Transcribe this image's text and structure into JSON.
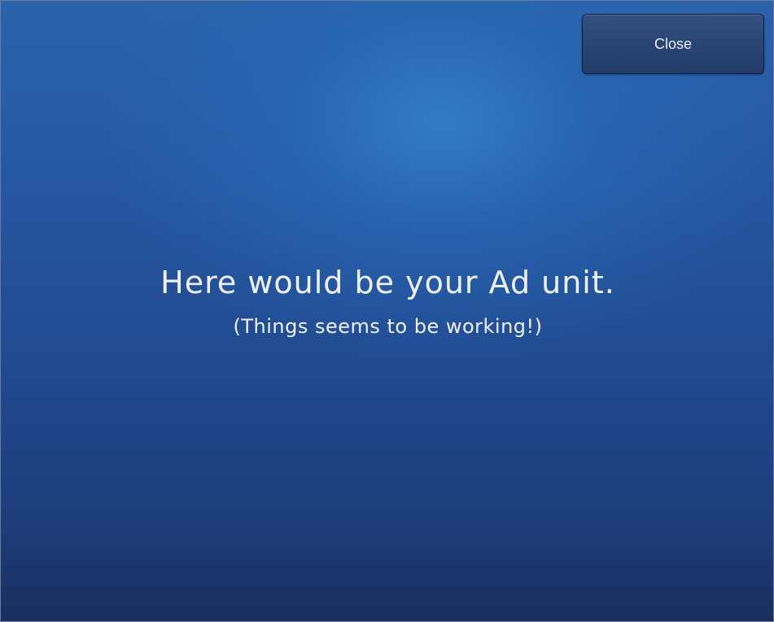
{
  "ad": {
    "close_label": "Close",
    "headline": "Here would be your Ad unit.",
    "subline": "(Things seems to be working!)"
  },
  "colors": {
    "background_top": "#2a62ab",
    "background_bottom": "#1a2f5f",
    "button": "#2b4676",
    "text": "#eef2f8"
  }
}
